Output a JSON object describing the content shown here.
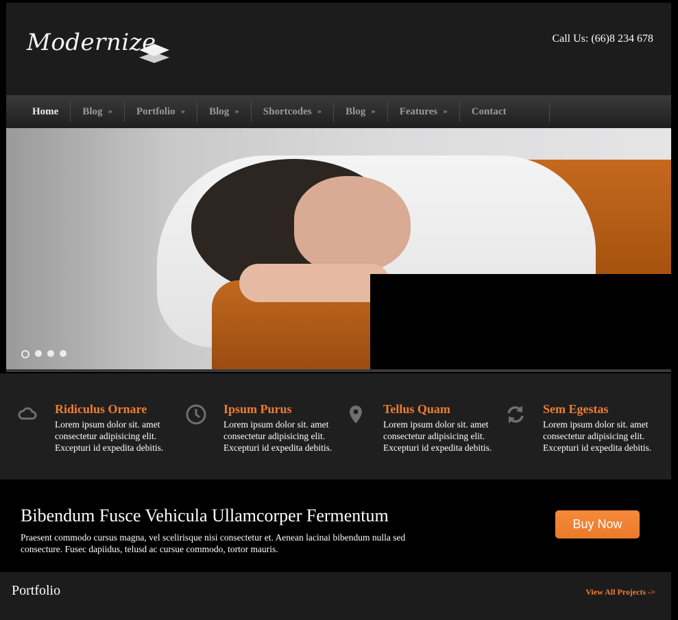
{
  "header": {
    "logo_text": "Modernize",
    "call_us": "Call Us: (66)8 234 678"
  },
  "nav": {
    "items": [
      {
        "label": "Home",
        "has_submenu": false,
        "active": true
      },
      {
        "label": "Blog",
        "has_submenu": true
      },
      {
        "label": "Portfolio",
        "has_submenu": true
      },
      {
        "label": "Blog",
        "has_submenu": true
      },
      {
        "label": "Shortcodes",
        "has_submenu": true
      },
      {
        "label": "Blog",
        "has_submenu": true
      },
      {
        "label": "Features",
        "has_submenu": true
      },
      {
        "label": "Contact",
        "has_submenu": false
      }
    ],
    "submenu_arrow": "»"
  },
  "slider": {
    "slide_count": 4,
    "active_slide": 1
  },
  "features": [
    {
      "icon": "cloud-icon",
      "title": "Ridiculus Ornare",
      "text": "Lorem ipsum dolor sit. amet consectetur adipisicing elit. Excepturi id expedita debitis."
    },
    {
      "icon": "clock-icon",
      "title": "Ipsum Purus",
      "text": "Lorem ipsum dolor sit. amet consectetur adipisicing elit. Excepturi id expedita debitis."
    },
    {
      "icon": "map-pin-icon",
      "title": "Tellus Quam",
      "text": "Lorem ipsum dolor sit. amet consectetur adipisicing elit. Excepturi id expedita debitis."
    },
    {
      "icon": "refresh-icon",
      "title": "Sem Egestas",
      "text": "Lorem ipsum dolor sit. amet consectetur adipisicing elit. Excepturi id expedita debitis."
    }
  ],
  "promo": {
    "title": "Bibendum Fusce Vehicula Ullamcorper Fermentum",
    "text": "Praesent commodo cursus magna, vel scelirisque nisi consectetur et. Aenean lacinai bibendum nulla sed consecture. Fusec dapiidus, telusd ac cursue commodo, tortor mauris.",
    "button_label": "Buy Now"
  },
  "portfolio": {
    "title": "Portfolio",
    "view_all": "View All Projects ->"
  },
  "colors": {
    "accent": "#f07e2e",
    "header_bg": "#1c1c1d",
    "page_bg": "#000000"
  }
}
